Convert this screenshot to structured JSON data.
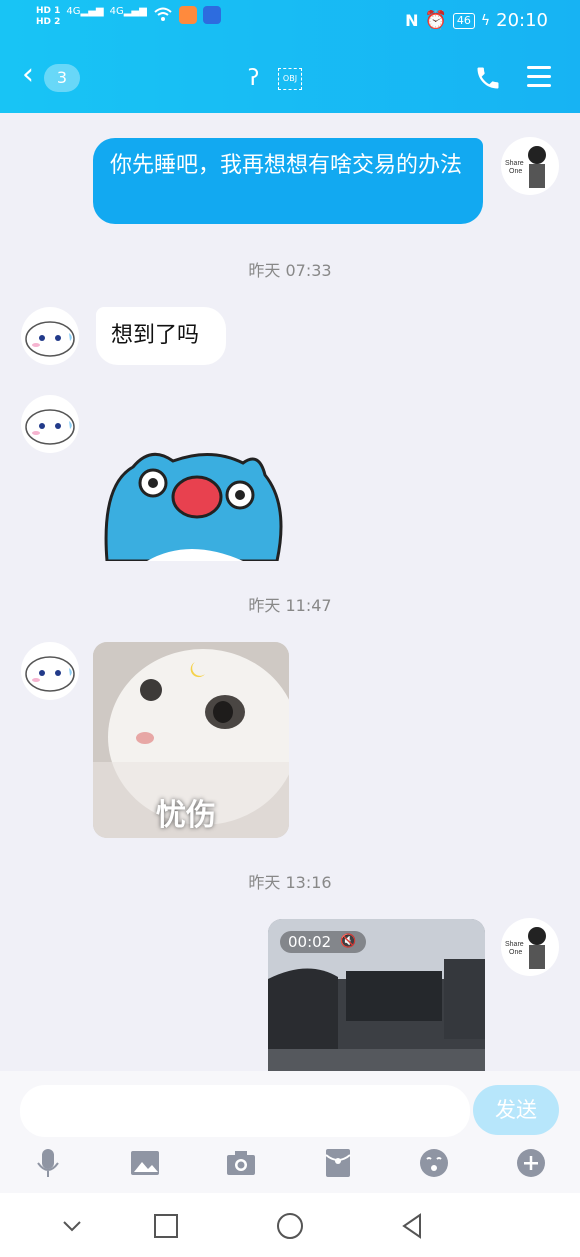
{
  "status_bar": {
    "hd_top": "HD 1",
    "hd_bottom": "HD 2",
    "net1": "4G",
    "net2": "4G",
    "battery": "46",
    "time": "20:10"
  },
  "header": {
    "unread_count": "3",
    "mode_label": "OBJ"
  },
  "messages": {
    "m1_text": "你先睡吧，我再想想有啥交易的办法",
    "t1": "昨天 07:33",
    "m2_text": "想到了吗",
    "t2": "昨天 11:47",
    "sticker_caption": "忧伤",
    "t3": "昨天 13:16",
    "video_duration": "00:02",
    "avatar_self_text": "Share One"
  },
  "input": {
    "placeholder": "",
    "send_label": "发送"
  },
  "colors": {
    "header": "#18c4f5",
    "bubble_self": "#12a9f1",
    "send_disabled": "#b7e6fb"
  },
  "toolbar_icons": [
    "mic-icon",
    "image-icon",
    "camera-icon",
    "red-packet-icon",
    "emoji-icon",
    "plus-icon"
  ],
  "system_nav_icons": [
    "collapse-icon",
    "recent-apps-icon",
    "home-icon",
    "back-icon"
  ]
}
